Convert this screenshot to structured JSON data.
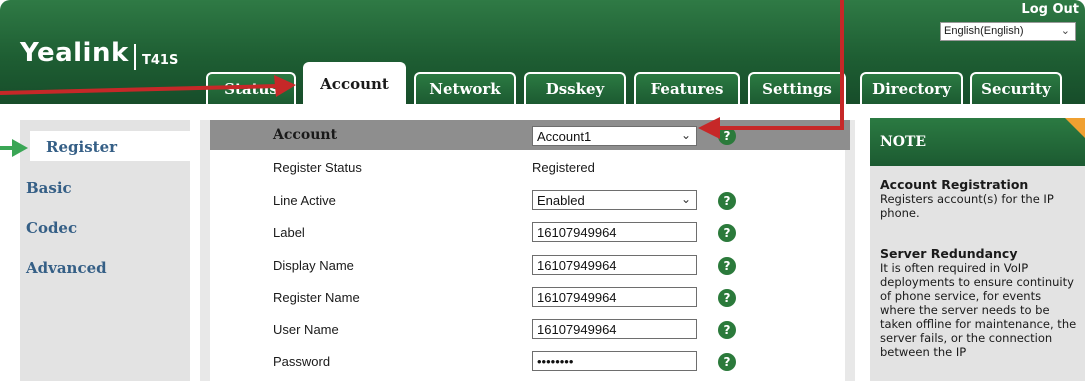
{
  "header": {
    "brand": "Yealink",
    "model": "T41S",
    "logout": "Log Out",
    "language": "English(English)"
  },
  "tabs": [
    {
      "label": "Status"
    },
    {
      "label": "Account"
    },
    {
      "label": "Network"
    },
    {
      "label": "Dsskey"
    },
    {
      "label": "Features"
    },
    {
      "label": "Settings"
    },
    {
      "label": "Directory"
    },
    {
      "label": "Security"
    }
  ],
  "sidebar": {
    "items": [
      {
        "label": "Register"
      },
      {
        "label": "Basic"
      },
      {
        "label": "Codec"
      },
      {
        "label": "Advanced"
      }
    ]
  },
  "form": {
    "account_label": "Account",
    "account_value": "Account1",
    "register_status_label": "Register Status",
    "register_status_value": "Registered",
    "line_active_label": "Line Active",
    "line_active_value": "Enabled",
    "label_label": "Label",
    "label_value": "16107949964",
    "display_name_label": "Display Name",
    "display_name_value": "16107949964",
    "register_name_label": "Register Name",
    "register_name_value": "16107949964",
    "user_name_label": "User Name",
    "user_name_value": "16107949964",
    "password_label": "Password",
    "password_value": "••••••••",
    "help_glyph": "?"
  },
  "note": {
    "title": "NOTE",
    "sections": [
      {
        "heading": "Account Registration",
        "text": "Registers account(s) for the IP phone."
      },
      {
        "heading": "Server Redundancy",
        "text": "It is often required in VoIP deployments to ensure continuity of phone service, for events where the server needs to be taken offline for maintenance, the server fails, or the connection between the IP"
      }
    ]
  },
  "colors": {
    "header_green": "#1e5e33",
    "nav_link": "#355f86",
    "help_green": "#2b7a3b",
    "arrow_red": "#c62828",
    "arrow_green": "#3aa655",
    "note_corner": "#f0a030"
  },
  "icons": {
    "dropdown": "chevron-down-icon",
    "help": "help-icon"
  }
}
